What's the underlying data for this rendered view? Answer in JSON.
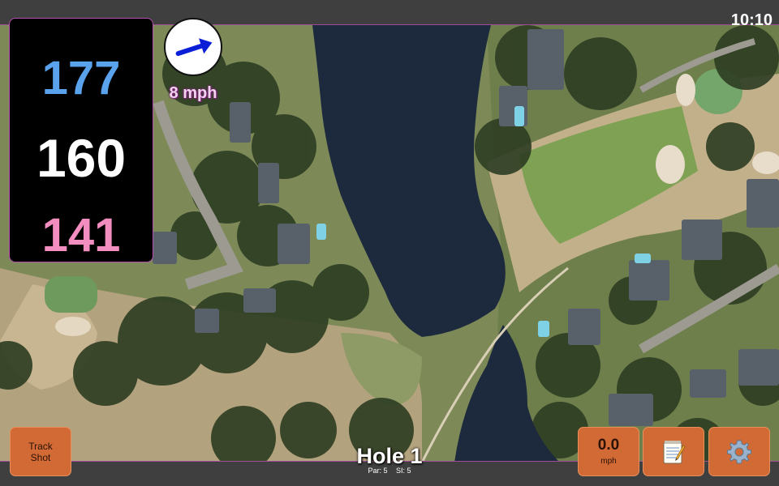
{
  "status": {
    "time": "10:10"
  },
  "yardages": {
    "back": "177",
    "middle": "160",
    "front": "141"
  },
  "wind": {
    "speed_label": "8 mph",
    "arrow_icon": "wind-direction-arrow-icon"
  },
  "hole": {
    "title": "Hole 1",
    "par": "Par: 5",
    "si": "SI: 5"
  },
  "buttons": {
    "track_shot": "Track Shot",
    "speed_value": "0.0",
    "speed_unit": "mph",
    "notes_icon": "notepad-icon",
    "settings_icon": "gear-icon"
  },
  "colors": {
    "back_yardage": "#5aa2ec",
    "middle_yardage": "#ffffff",
    "front_yardage": "#f28dbf",
    "button": "#d26a35",
    "map_border": "#a04a9a"
  }
}
